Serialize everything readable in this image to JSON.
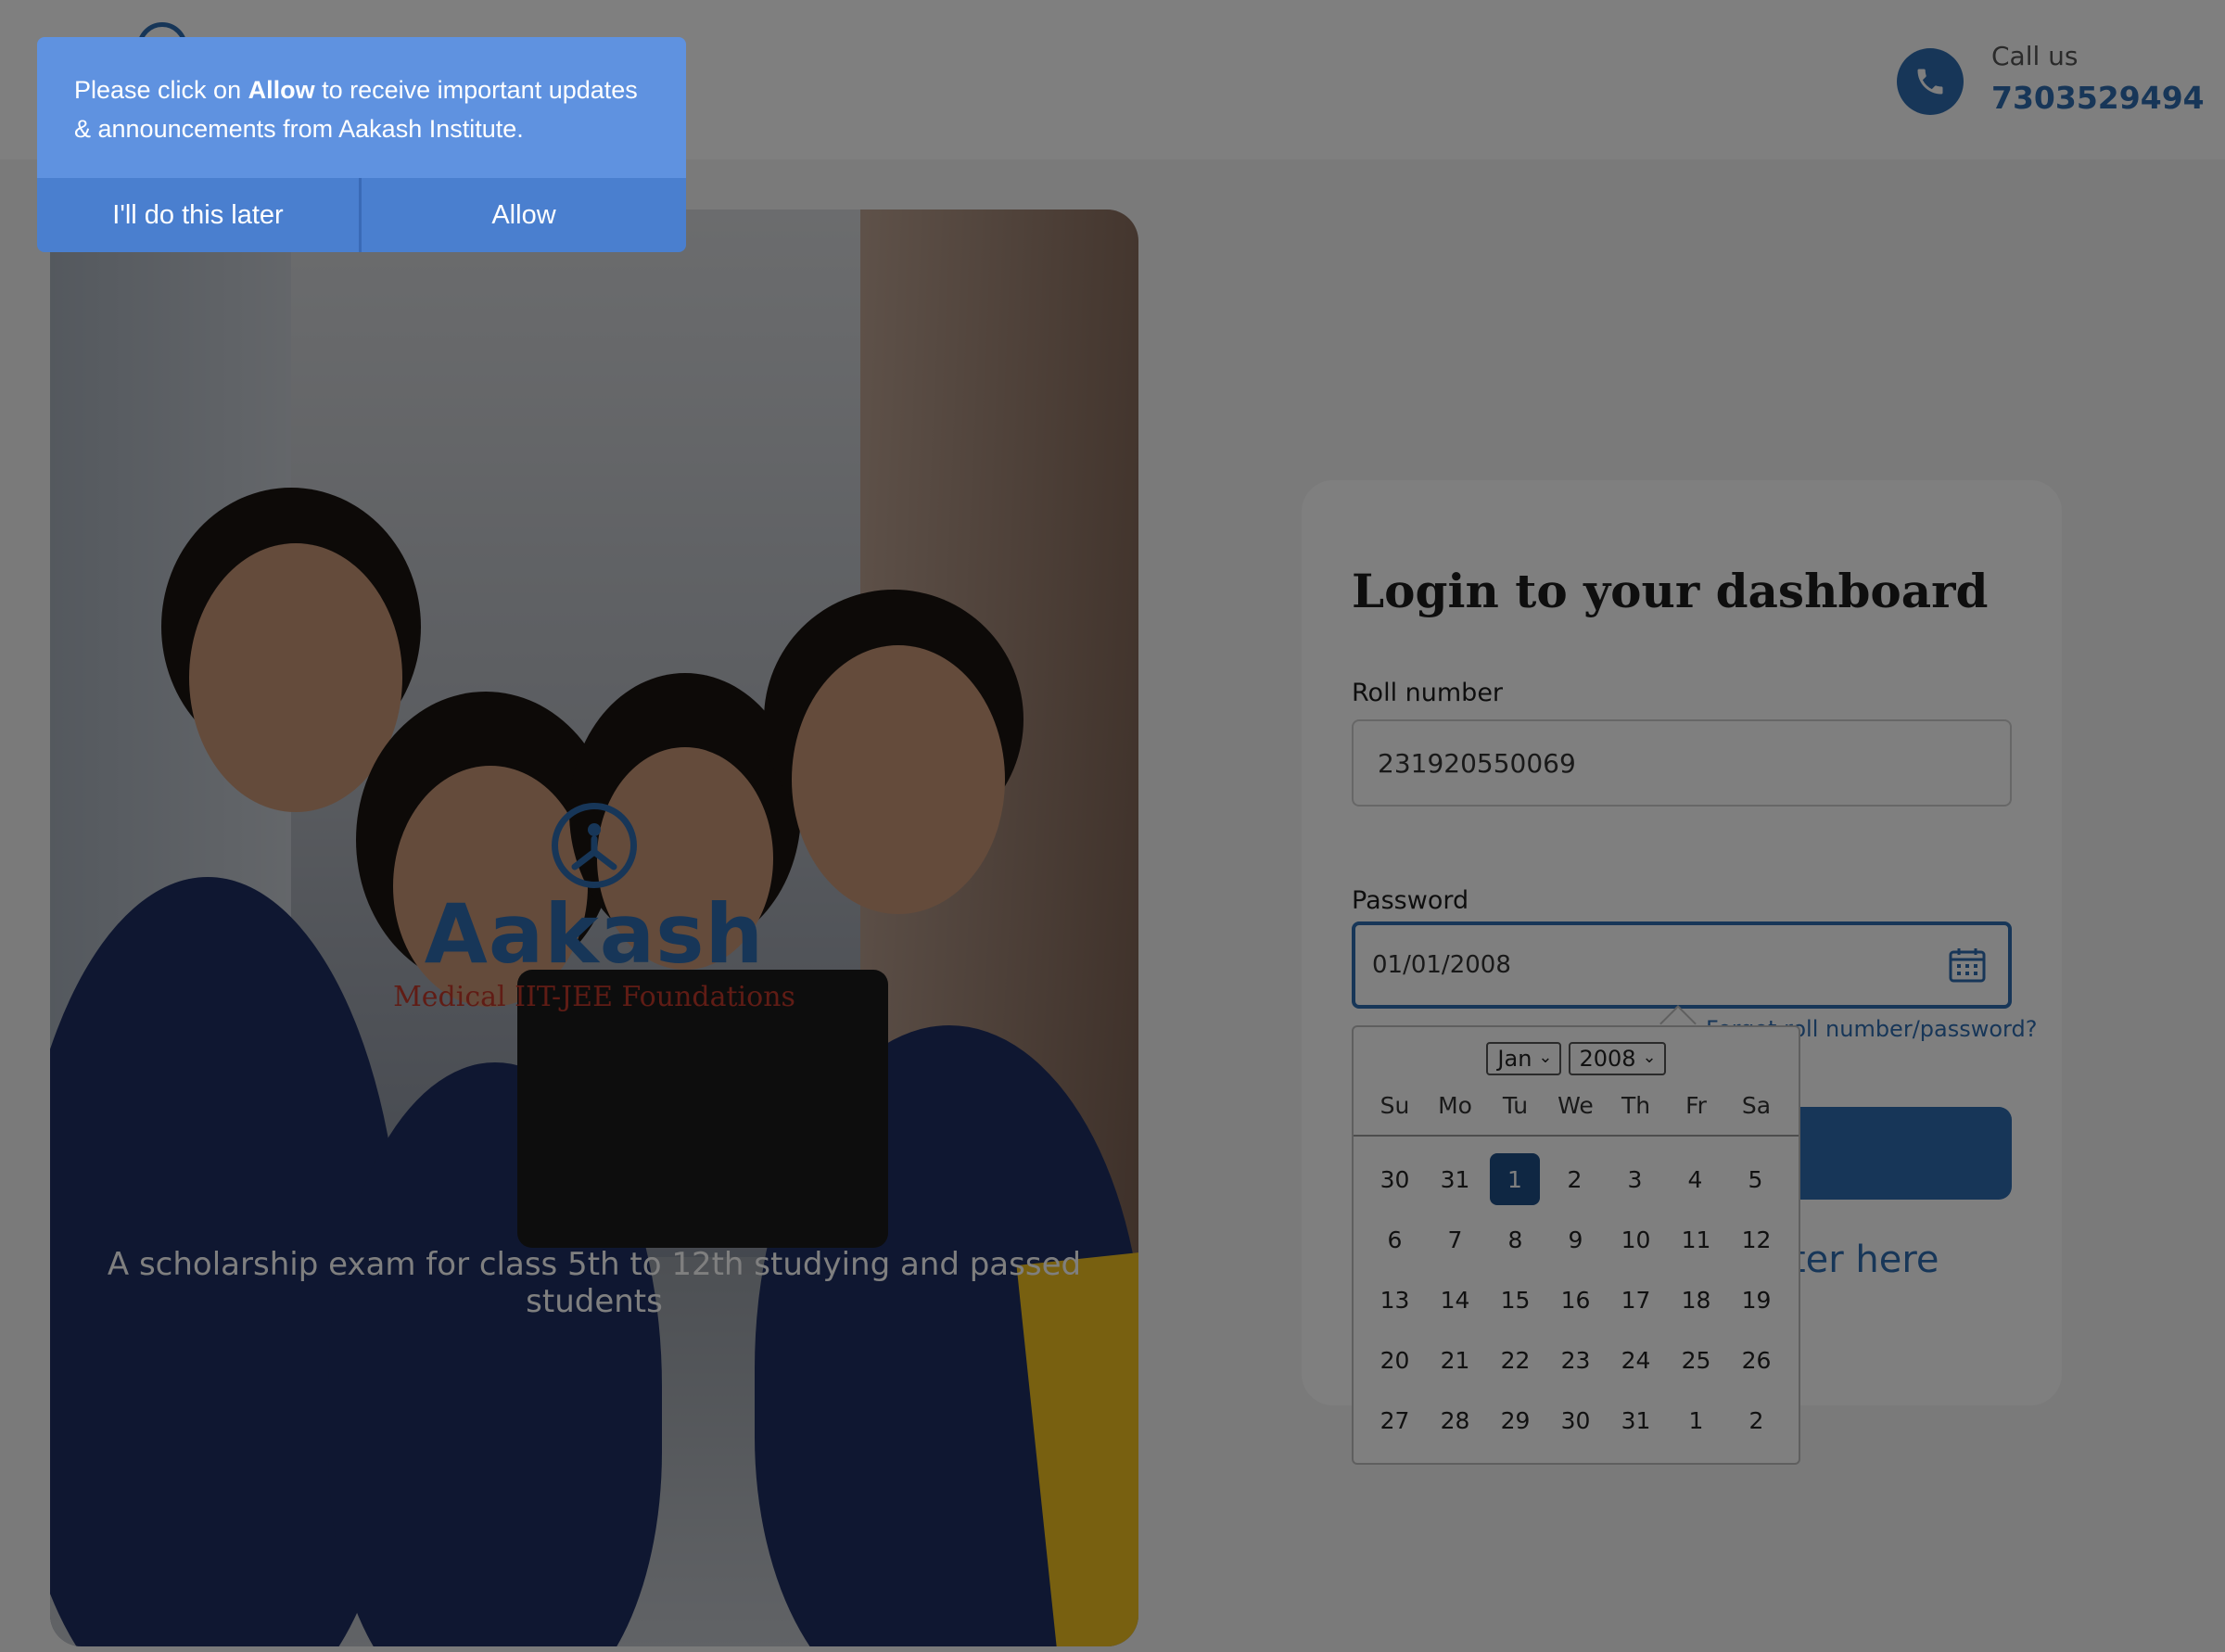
{
  "header": {
    "call_label": "Call us",
    "call_number": "7303529494"
  },
  "hero": {
    "logo_word": "Aakash",
    "logo_subtitle": "Medical IIT-JEE Foundations",
    "caption": "A scholarship exam for class 5th to 12th studying and passed students"
  },
  "login": {
    "title": "Login to your dashboard",
    "roll_label": "Roll number",
    "roll_value": "231920550069",
    "password_label": "Password",
    "password_value": "01/01/2008",
    "forgot_text": "Forgot roll number/password?",
    "register_text": "Register here"
  },
  "datepicker": {
    "month": "Jan",
    "year": "2008",
    "weekdays": [
      "Su",
      "Mo",
      "Tu",
      "We",
      "Th",
      "Fr",
      "Sa"
    ],
    "weeks": [
      [
        "30",
        "31",
        "1",
        "2",
        "3",
        "4",
        "5"
      ],
      [
        "6",
        "7",
        "8",
        "9",
        "10",
        "11",
        "12"
      ],
      [
        "13",
        "14",
        "15",
        "16",
        "17",
        "18",
        "19"
      ],
      [
        "20",
        "21",
        "22",
        "23",
        "24",
        "25",
        "26"
      ],
      [
        "27",
        "28",
        "29",
        "30",
        "31",
        "1",
        "2"
      ]
    ],
    "selected_day": "1"
  },
  "push_prompt": {
    "message_before": "Please click on ",
    "message_bold": "Allow",
    "message_after": " to receive important updates & announcements from Aakash Institute.",
    "later_label": "I'll do this later",
    "allow_label": "Allow"
  },
  "colors": {
    "brand_blue": "#2f6db0",
    "push_blue": "#5f92e0",
    "selected_day": "#1f4f86"
  },
  "icons": [
    "brand-logo-icon",
    "phone-icon",
    "calendar-icon",
    "chevron-down-icon"
  ]
}
